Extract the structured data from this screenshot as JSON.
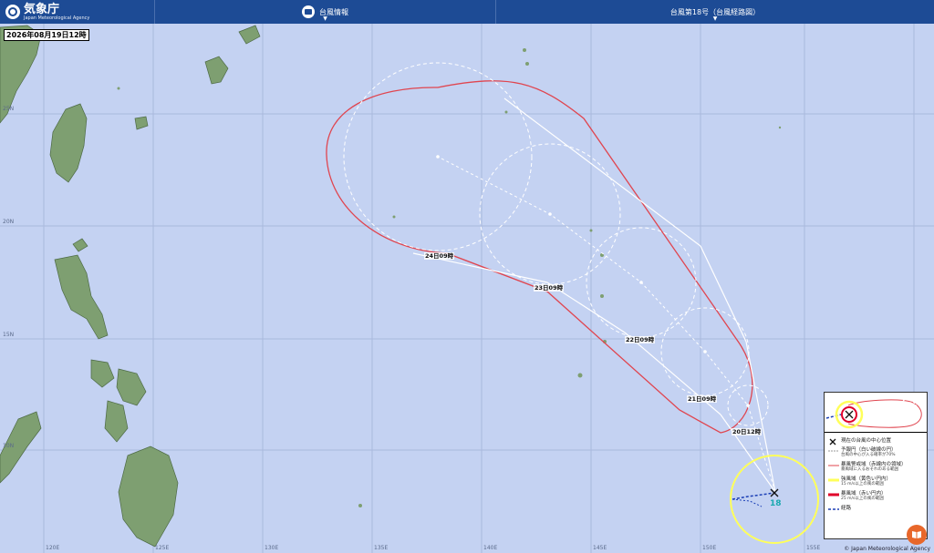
{
  "header": {
    "logo_ja": "気象庁",
    "logo_en": "Japan Meteorological Agency",
    "menu_label": "台風情報",
    "title": "台風第18号（台風経路図）"
  },
  "map": {
    "datetime": "2026年08月19日12時",
    "typhoon_number": "18",
    "lat_labels": [
      "25N",
      "20N",
      "15N",
      "10N"
    ],
    "lon_labels": [
      "120E",
      "125E",
      "130E",
      "135E",
      "140E",
      "145E",
      "150E",
      "155E"
    ],
    "forecast_labels": [
      "24日09時",
      "23日09時",
      "22日09時",
      "21日09時",
      "20日12時"
    ],
    "colors": {
      "storm_warning": "#e0454f",
      "strong_wind": "#ffff5a",
      "storm_area": "#e0002a",
      "track": "#1b3fb6",
      "land": "#7e9f71",
      "sea": "#c4d2f2"
    }
  },
  "legend": {
    "items": [
      {
        "main": "現在の台風の中心位置",
        "sub": ""
      },
      {
        "main": "予報円（白い破線の円）",
        "sub": "台風の中心が入る確率が70%"
      },
      {
        "main": "暴風警戒域（赤線内の領域）",
        "sub": "暴風域に入るおそれのある範囲"
      },
      {
        "main": "強風域（黄色い円内）",
        "sub": "15 m/s以上の風の範囲"
      },
      {
        "main": "暴風域（赤い円内）",
        "sub": "25 m/s以上の風の範囲"
      },
      {
        "main": "経路",
        "sub": ""
      }
    ]
  },
  "footer": {
    "copyright": "© Japan Meteorological Agency"
  }
}
